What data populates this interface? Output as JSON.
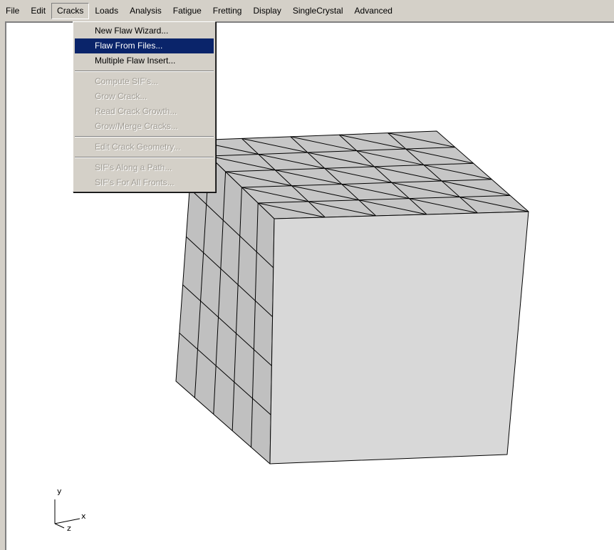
{
  "menubar": {
    "items": [
      "File",
      "Edit",
      "Cracks",
      "Loads",
      "Analysis",
      "Fatigue",
      "Fretting",
      "Display",
      "SingleCrystal",
      "Advanced"
    ],
    "open_item": "Cracks"
  },
  "cracks_menu": {
    "group1": [
      "New Flaw Wizard...",
      "Flaw From Files...",
      "Multiple Flaw Insert..."
    ],
    "group2": [
      "Compute SIF's...",
      "Grow Crack...",
      "Read Crack Growth...",
      "Grow/Merge Cracks..."
    ],
    "group3": [
      "Edit Crack Geometry..."
    ],
    "group4": [
      "SIF's Along a Path...",
      "SIF's For All Fronts..."
    ],
    "selected": "Flaw From Files..."
  },
  "axis_triad": {
    "y_label": "y",
    "x_label": "x",
    "z_label": "z"
  },
  "colors": {
    "selection": "#0a246a",
    "face_front": "#d8d8d8",
    "face_side": "#c0c0c0",
    "face_top": "#c6c6c6",
    "menu_background": "#d4d0c8"
  }
}
